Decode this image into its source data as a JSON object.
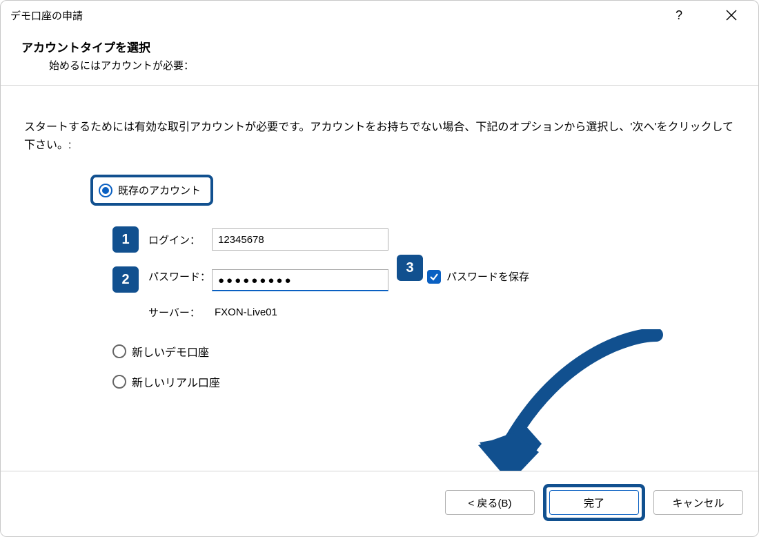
{
  "titlebar": {
    "title": "デモ口座の申請"
  },
  "header": {
    "heading": "アカウントタイプを選択",
    "sub": "始めるにはアカウントが必要："
  },
  "instruction": "スタートするためには有効な取引アカウントが必要です。アカウントをお持ちでない場合、下記のオプションから選択し、'次へ'をクリックして下さい。:",
  "options": {
    "existing": "既存のアカウント",
    "demo": "新しいデモ口座",
    "real": "新しいリアル口座"
  },
  "form": {
    "login_label": "ログイン：",
    "login_value": "12345678",
    "password_label": "パスワード：",
    "password_value": "●●●●●●●●●",
    "server_label": "サーバー：",
    "server_value": "FXON-Live01",
    "save_password": "パスワードを保存"
  },
  "badges": {
    "b1": "1",
    "b2": "2",
    "b3": "3"
  },
  "footer": {
    "back": "< 戻る(B)",
    "finish": "完了",
    "cancel": "キャンセル"
  }
}
